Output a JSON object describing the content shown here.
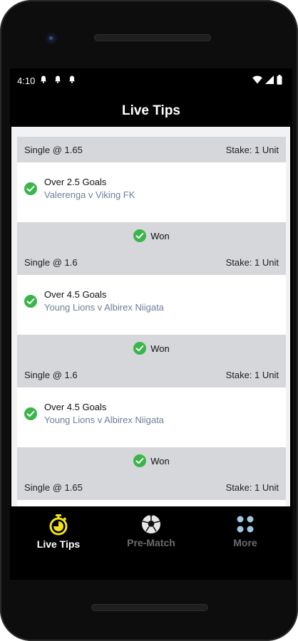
{
  "status_bar": {
    "time": "4:10",
    "notification_icons": [
      "bell-icon",
      "bell-icon",
      "bell-icon"
    ],
    "right_icons": [
      "wifi-icon",
      "signal-icon",
      "battery-icon"
    ]
  },
  "header": {
    "title": "Live Tips"
  },
  "tips": [
    {
      "bet_type": "Single @ 1.65",
      "stake": "Stake: 1 Unit",
      "market": "Over 2.5 Goals",
      "match": "Valerenga v Viking FK",
      "result": "Won"
    },
    {
      "bet_type": "Single @ 1.6",
      "stake": "Stake: 1 Unit",
      "market": "Over 4.5 Goals",
      "match": "Young Lions v Albirex Niigata",
      "result": "Won"
    },
    {
      "bet_type": "Single @ 1.6",
      "stake": "Stake: 1 Unit",
      "market": "Over 4.5 Goals",
      "match": "Young Lions v Albirex Niigata",
      "result": "Won"
    },
    {
      "bet_type": "Single @ 1.65",
      "stake": "Stake: 1 Unit"
    }
  ],
  "bottom_nav": {
    "items": [
      {
        "label": "Live Tips",
        "icon": "stopwatch-icon",
        "active": true
      },
      {
        "label": "Pre-Match",
        "icon": "soccer-ball-icon",
        "active": false
      },
      {
        "label": "More",
        "icon": "grid-dots-icon",
        "active": false
      }
    ]
  },
  "colors": {
    "accent": "#f2e11c",
    "won_green": "#3ab54a",
    "card_header_bg": "#d6d7db",
    "match_text": "#6b7f99",
    "inactive_nav": "#6b6b6b"
  }
}
